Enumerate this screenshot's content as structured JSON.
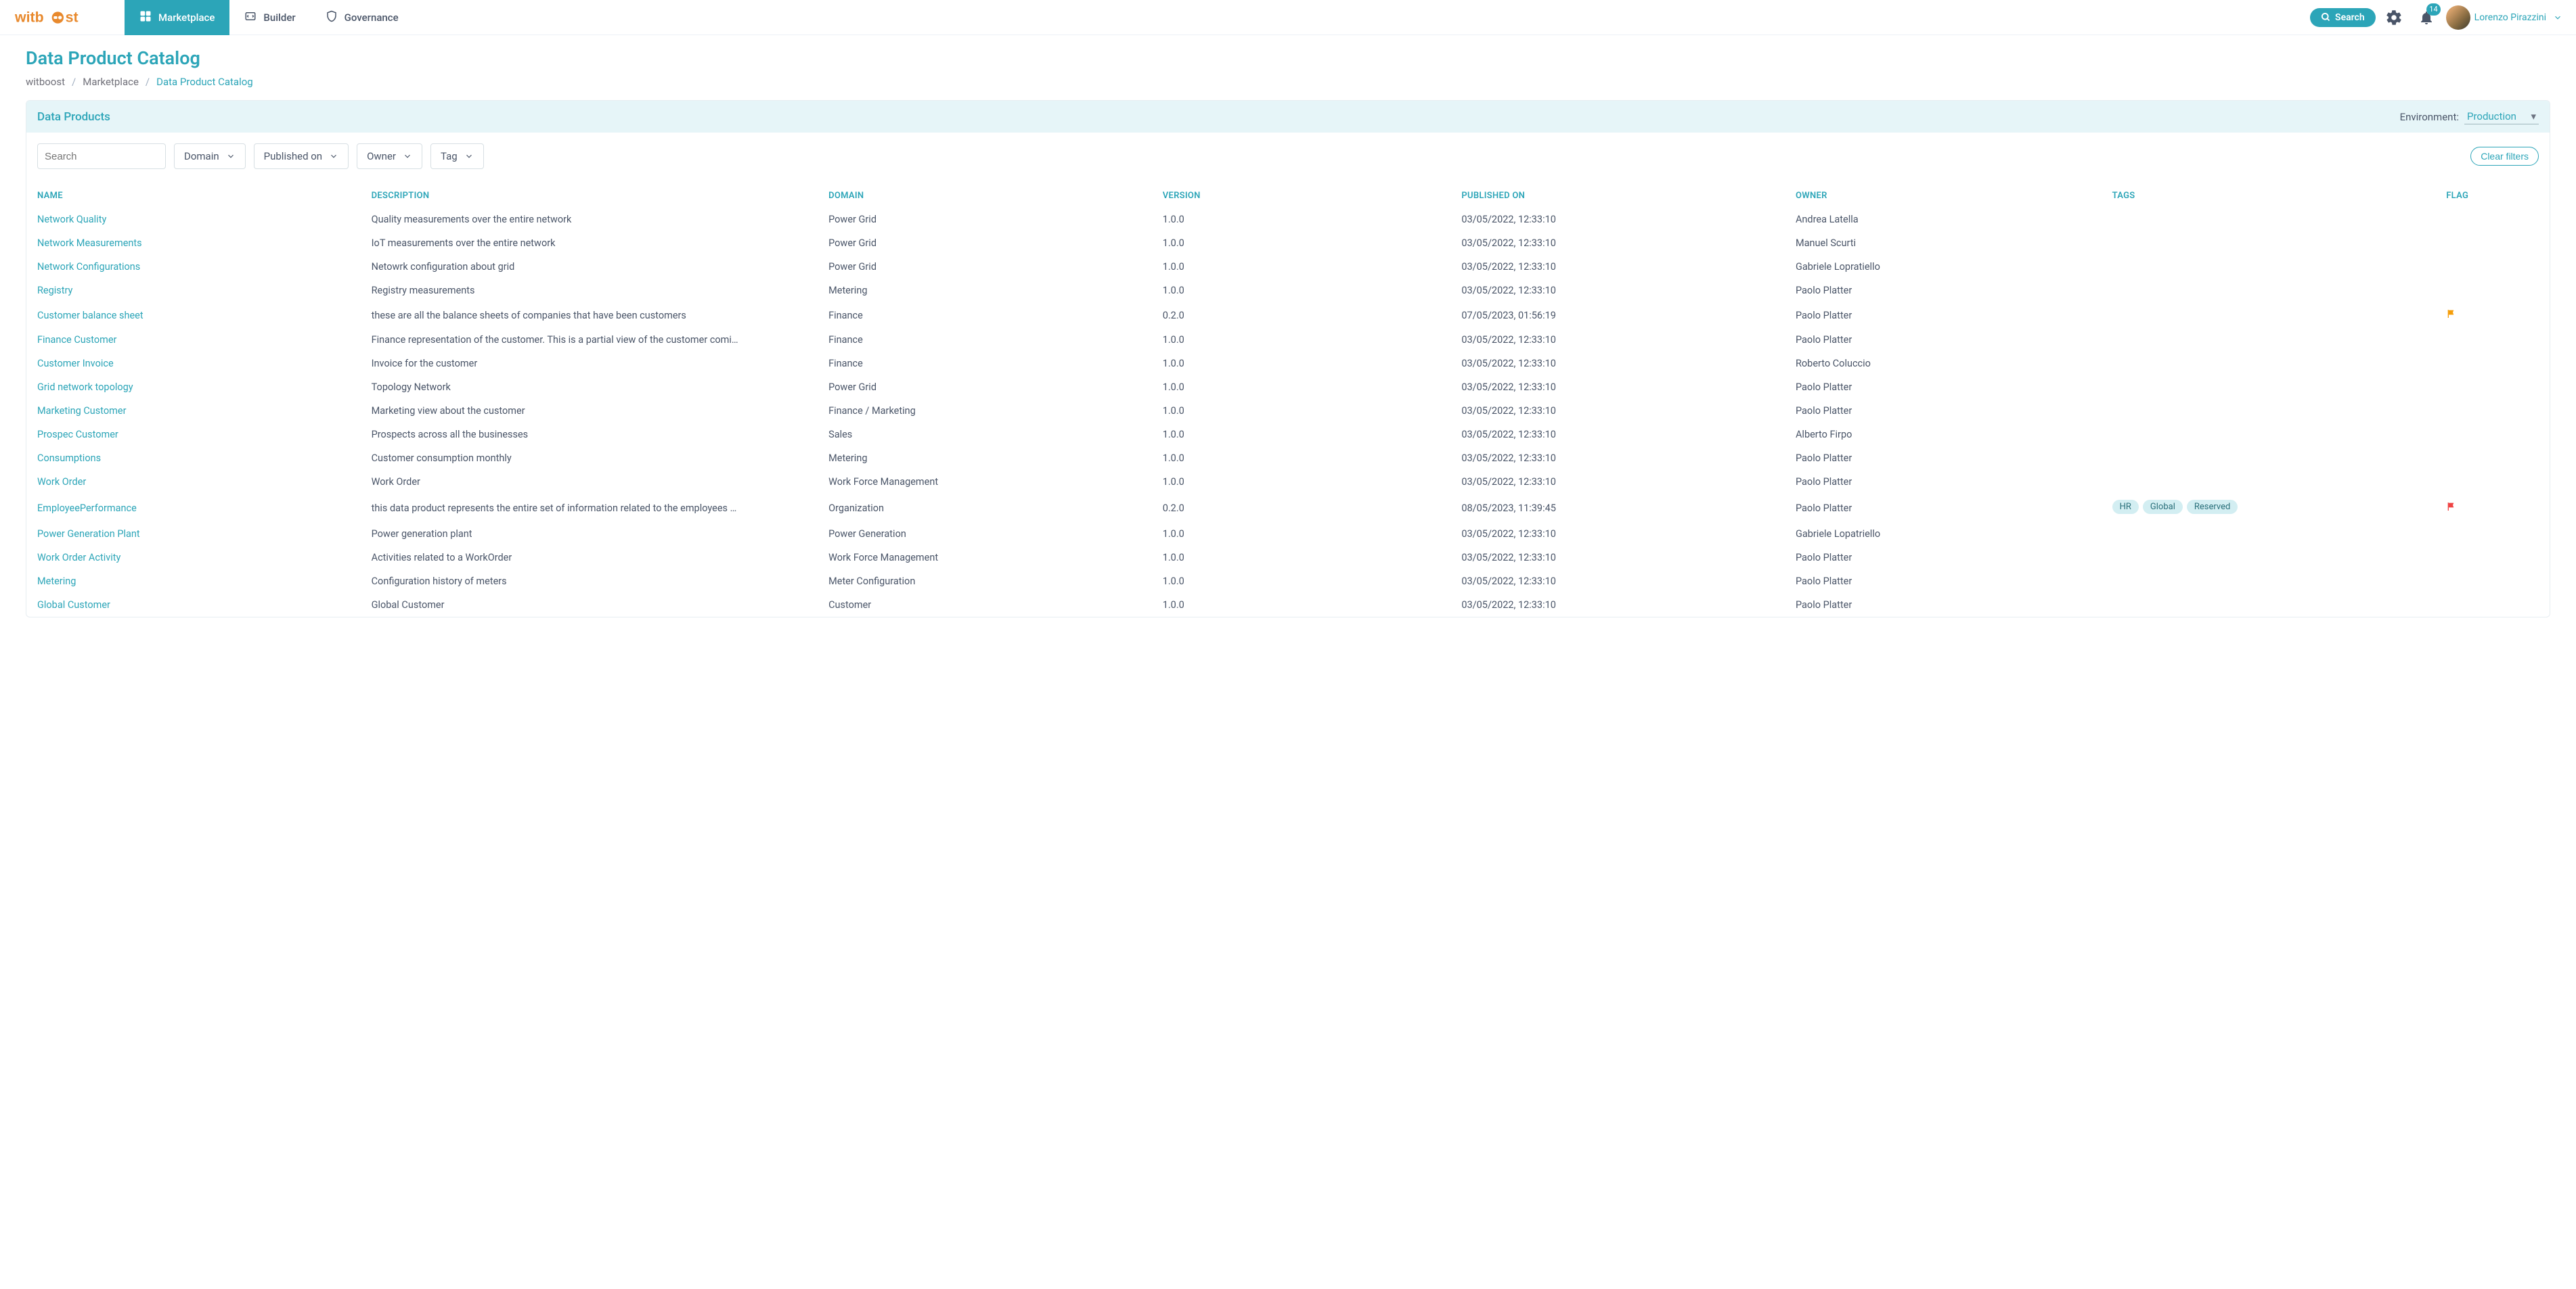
{
  "brand": "witboost",
  "nav": [
    {
      "id": "marketplace",
      "label": "Marketplace",
      "active": true
    },
    {
      "id": "builder",
      "label": "Builder",
      "active": false
    },
    {
      "id": "governance",
      "label": "Governance",
      "active": false
    }
  ],
  "topSearch": {
    "label": "Search"
  },
  "notifications": {
    "count": "14"
  },
  "user": {
    "name": "Lorenzo Pirazzini"
  },
  "page": {
    "title": "Data Product Catalog",
    "breadcrumb": [
      {
        "label": "witboost",
        "current": false
      },
      {
        "label": "Marketplace",
        "current": false
      },
      {
        "label": "Data Product Catalog",
        "current": true
      }
    ]
  },
  "card": {
    "title": "Data Products",
    "environmentLabel": "Environment:",
    "environmentValue": "Production"
  },
  "filters": {
    "searchPlaceholder": "Search",
    "pills": [
      "Domain",
      "Published on",
      "Owner",
      "Tag"
    ],
    "clear": "Clear filters"
  },
  "columns": [
    "NAME",
    "DESCRIPTION",
    "DOMAIN",
    "VERSION",
    "PUBLISHED ON",
    "OWNER",
    "TAGS",
    "FLAG"
  ],
  "rows": [
    {
      "name": "Network Quality",
      "desc": "Quality measurements over the entire network",
      "domain": "Power Grid",
      "version": "1.0.0",
      "pub": "03/05/2022, 12:33:10",
      "owner": "Andrea Latella",
      "tags": [],
      "flag": ""
    },
    {
      "name": "Network Measurements",
      "desc": "IoT measurements over the entire network",
      "domain": "Power Grid",
      "version": "1.0.0",
      "pub": "03/05/2022, 12:33:10",
      "owner": "Manuel Scurti",
      "tags": [],
      "flag": ""
    },
    {
      "name": "Network Configurations",
      "desc": "Netowrk configuration about grid",
      "domain": "Power Grid",
      "version": "1.0.0",
      "pub": "03/05/2022, 12:33:10",
      "owner": "Gabriele Lopratiello",
      "tags": [],
      "flag": ""
    },
    {
      "name": "Registry",
      "desc": "Registry measurements",
      "domain": "Metering",
      "version": "1.0.0",
      "pub": "03/05/2022, 12:33:10",
      "owner": "Paolo Platter",
      "tags": [],
      "flag": ""
    },
    {
      "name": "Customer balance sheet",
      "desc": "these are all the balance sheets of companies that have been customers",
      "domain": "Finance",
      "version": "0.2.0",
      "pub": "07/05/2023, 01:56:19",
      "owner": "Paolo Platter",
      "tags": [],
      "flag": "orange"
    },
    {
      "name": "Finance Customer",
      "desc": "Finance representation of the customer. This is a partial view of the customer comi…",
      "domain": "Finance",
      "version": "1.0.0",
      "pub": "03/05/2022, 12:33:10",
      "owner": "Paolo Platter",
      "tags": [],
      "flag": ""
    },
    {
      "name": "Customer Invoice",
      "desc": "Invoice for the customer",
      "domain": "Finance",
      "version": "1.0.0",
      "pub": "03/05/2022, 12:33:10",
      "owner": "Roberto Coluccio",
      "tags": [],
      "flag": ""
    },
    {
      "name": "Grid network topology",
      "desc": "Topology Network",
      "domain": "Power Grid",
      "version": "1.0.0",
      "pub": "03/05/2022, 12:33:10",
      "owner": "Paolo Platter",
      "tags": [],
      "flag": ""
    },
    {
      "name": "Marketing Customer",
      "desc": "Marketing view about the customer",
      "domain": "Finance / Marketing",
      "version": "1.0.0",
      "pub": "03/05/2022, 12:33:10",
      "owner": "Paolo Platter",
      "tags": [],
      "flag": ""
    },
    {
      "name": "Prospec Customer",
      "desc": "Prospects across all the businesses",
      "domain": "Sales",
      "version": "1.0.0",
      "pub": "03/05/2022, 12:33:10",
      "owner": "Alberto Firpo",
      "tags": [],
      "flag": ""
    },
    {
      "name": "Consumptions",
      "desc": "Customer consumption monthly",
      "domain": "Metering",
      "version": "1.0.0",
      "pub": "03/05/2022, 12:33:10",
      "owner": "Paolo Platter",
      "tags": [],
      "flag": ""
    },
    {
      "name": "Work Order",
      "desc": "Work Order",
      "domain": "Work Force Management",
      "version": "1.0.0",
      "pub": "03/05/2022, 12:33:10",
      "owner": "Paolo Platter",
      "tags": [],
      "flag": ""
    },
    {
      "name": "EmployeePerformance",
      "desc": "this data product represents the entire set of information related to the employees …",
      "domain": "Organization",
      "version": "0.2.0",
      "pub": "08/05/2023, 11:39:45",
      "owner": "Paolo Platter",
      "tags": [
        "HR",
        "Global",
        "Reserved"
      ],
      "flag": "red"
    },
    {
      "name": "Power Generation Plant",
      "desc": "Power generation plant",
      "domain": "Power Generation",
      "version": "1.0.0",
      "pub": "03/05/2022, 12:33:10",
      "owner": "Gabriele Lopatriello",
      "tags": [],
      "flag": ""
    },
    {
      "name": "Work Order Activity",
      "desc": "Activities related to a WorkOrder",
      "domain": "Work Force Management",
      "version": "1.0.0",
      "pub": "03/05/2022, 12:33:10",
      "owner": "Paolo Platter",
      "tags": [],
      "flag": ""
    },
    {
      "name": "Metering",
      "desc": "Configuration history of meters",
      "domain": "Meter Configuration",
      "version": "1.0.0",
      "pub": "03/05/2022, 12:33:10",
      "owner": "Paolo Platter",
      "tags": [],
      "flag": ""
    },
    {
      "name": "Global Customer",
      "desc": "Global Customer",
      "domain": "Customer",
      "version": "1.0.0",
      "pub": "03/05/2022, 12:33:10",
      "owner": "Paolo Platter",
      "tags": [],
      "flag": ""
    }
  ]
}
